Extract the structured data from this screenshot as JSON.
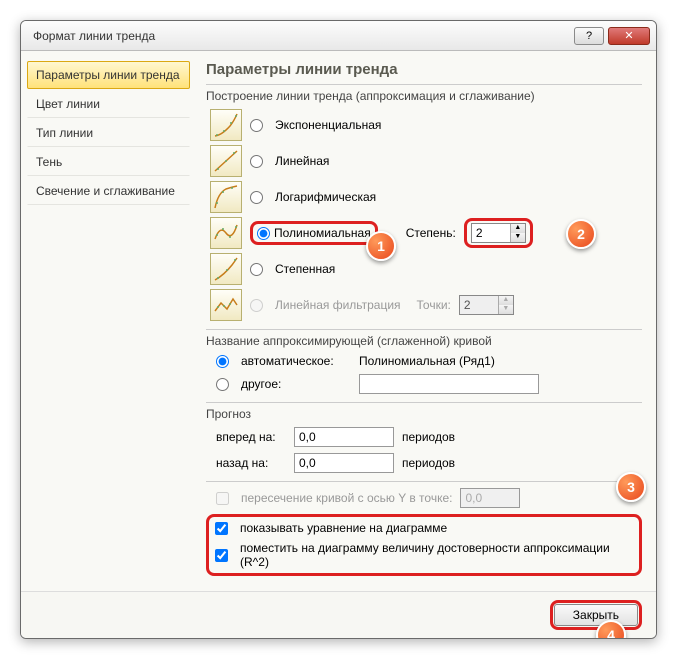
{
  "window": {
    "title": "Формат линии тренда"
  },
  "sidebar": {
    "items": [
      {
        "label": "Параметры линии тренда"
      },
      {
        "label": "Цвет линии"
      },
      {
        "label": "Тип линии"
      },
      {
        "label": "Тень"
      },
      {
        "label": "Свечение и сглаживание"
      }
    ]
  },
  "main": {
    "heading": "Параметры линии тренда",
    "buildGroup": "Построение линии тренда (аппроксимация и сглаживание)",
    "types": {
      "exp": "Экспоненциальная",
      "lin": "Линейная",
      "log": "Логарифмическая",
      "poly": "Полиномиальная",
      "pow": "Степенная",
      "movavg": "Линейная фильтрация"
    },
    "degreeLabel": "Степень:",
    "degreeValue": "2",
    "pointsLabel": "Точки:",
    "pointsValue": "2",
    "nameGroup": "Название аппроксимирующей (сглаженной) кривой",
    "nameAuto": "автоматическое:",
    "nameAutoValue": "Полиномиальная (Ряд1)",
    "nameOther": "другое:",
    "forecastGroup": "Прогноз",
    "forecastFwd": "вперед на:",
    "forecastBack": "назад на:",
    "forecastFwdVal": "0,0",
    "forecastBackVal": "0,0",
    "periods": "периодов",
    "intercept": "пересечение кривой с осью Y в точке:",
    "interceptVal": "0,0",
    "showEq": "показывать уравнение на диаграмме",
    "showR2": "поместить на диаграмму величину достоверности аппроксимации (R^2)"
  },
  "footer": {
    "close": "Закрыть"
  },
  "anno": {
    "a1": "1",
    "a2": "2",
    "a3": "3",
    "a4": "4"
  }
}
